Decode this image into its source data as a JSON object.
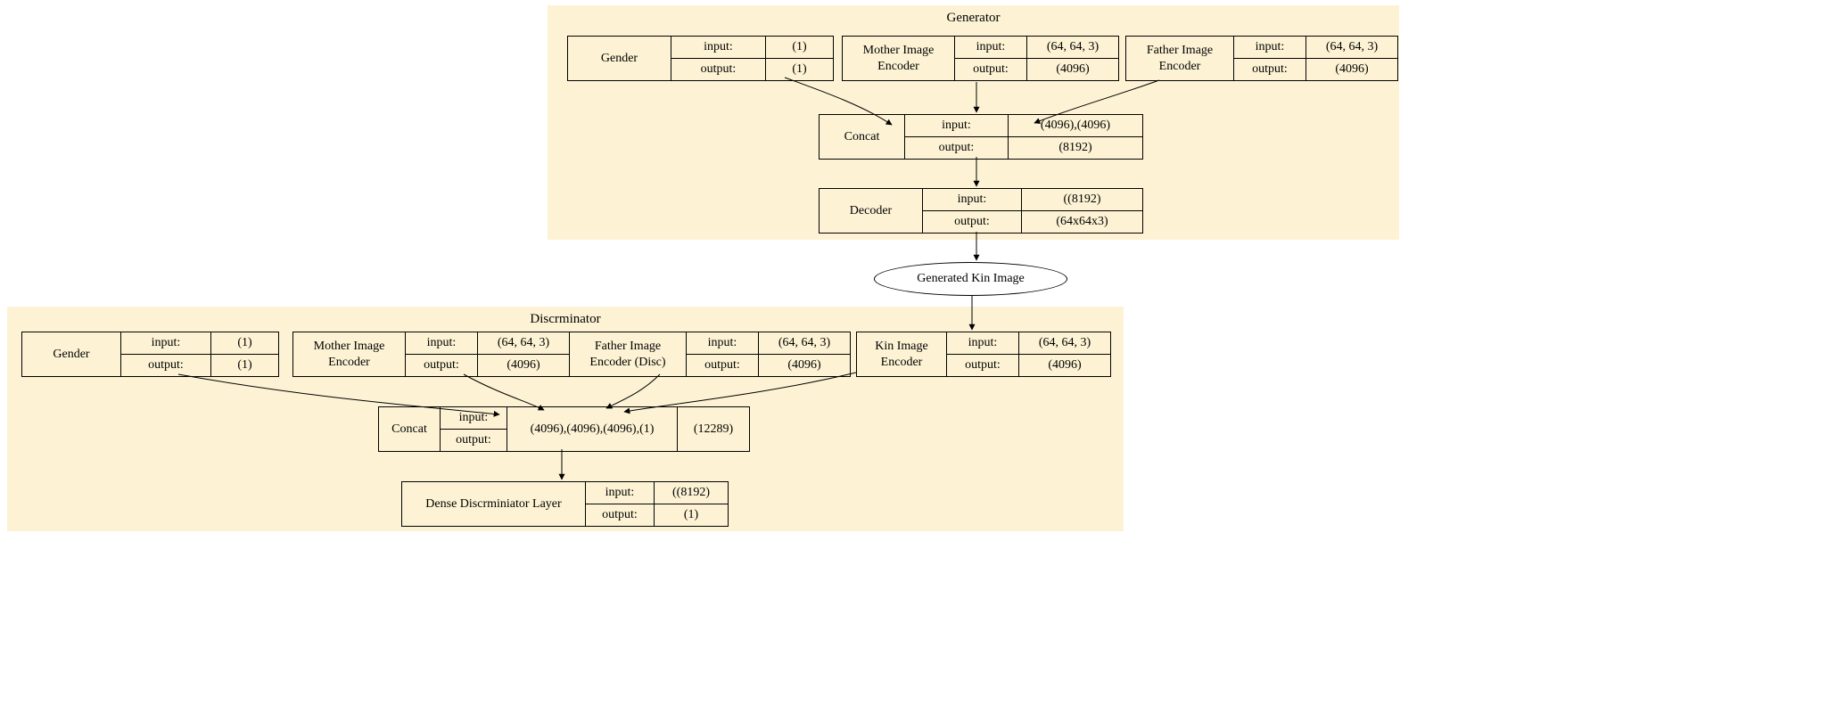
{
  "generator": {
    "title": "Generator",
    "gender": {
      "label": "Gender",
      "input_l": "input:",
      "input_v": "(1)",
      "output_l": "output:",
      "output_v": "(1)"
    },
    "mother": {
      "label": "Mother Image\nEncoder",
      "input_l": "input:",
      "input_v": "(64, 64, 3)",
      "output_l": "output:",
      "output_v": "(4096)"
    },
    "father": {
      "label": "Father Image\nEncoder",
      "input_l": "input:",
      "input_v": "(64, 64, 3)",
      "output_l": "output:",
      "output_v": "(4096)"
    },
    "concat": {
      "label": "Concat",
      "input_l": "input:",
      "input_v": "(4096),(4096)",
      "output_l": "output:",
      "output_v": "(8192)"
    },
    "decoder": {
      "label": "Decoder",
      "input_l": "input:",
      "input_v": "((8192)",
      "output_l": "output:",
      "output_v": "(64x64x3)"
    }
  },
  "generated_kin": "Generated Kin Image",
  "discriminator": {
    "title": "Discrminator",
    "gender": {
      "label": "Gender",
      "input_l": "input:",
      "input_v": "(1)",
      "output_l": "output:",
      "output_v": "(1)"
    },
    "mother": {
      "label": "Mother Image\nEncoder",
      "input_l": "input:",
      "input_v": "(64, 64, 3)",
      "output_l": "output:",
      "output_v": "(4096)"
    },
    "father": {
      "label": "Father Image\nEncoder (Disc)",
      "input_l": "input:",
      "input_v": "(64, 64, 3)",
      "output_l": "output:",
      "output_v": "(4096)"
    },
    "kin": {
      "label": "Kin Image\nEncoder",
      "input_l": "input:",
      "input_v": "(64, 64, 3)",
      "output_l": "output:",
      "output_v": "(4096)"
    },
    "concat": {
      "label": "Concat",
      "input_l": "input:",
      "input_v": "(4096),(4096),(4096),(1)",
      "output_l": "output:",
      "extra": "(12289)"
    },
    "dense": {
      "label": "Dense Discrminiator Layer",
      "input_l": "input:",
      "input_v": "((8192)",
      "output_l": "output:",
      "output_v": "(1)"
    }
  }
}
